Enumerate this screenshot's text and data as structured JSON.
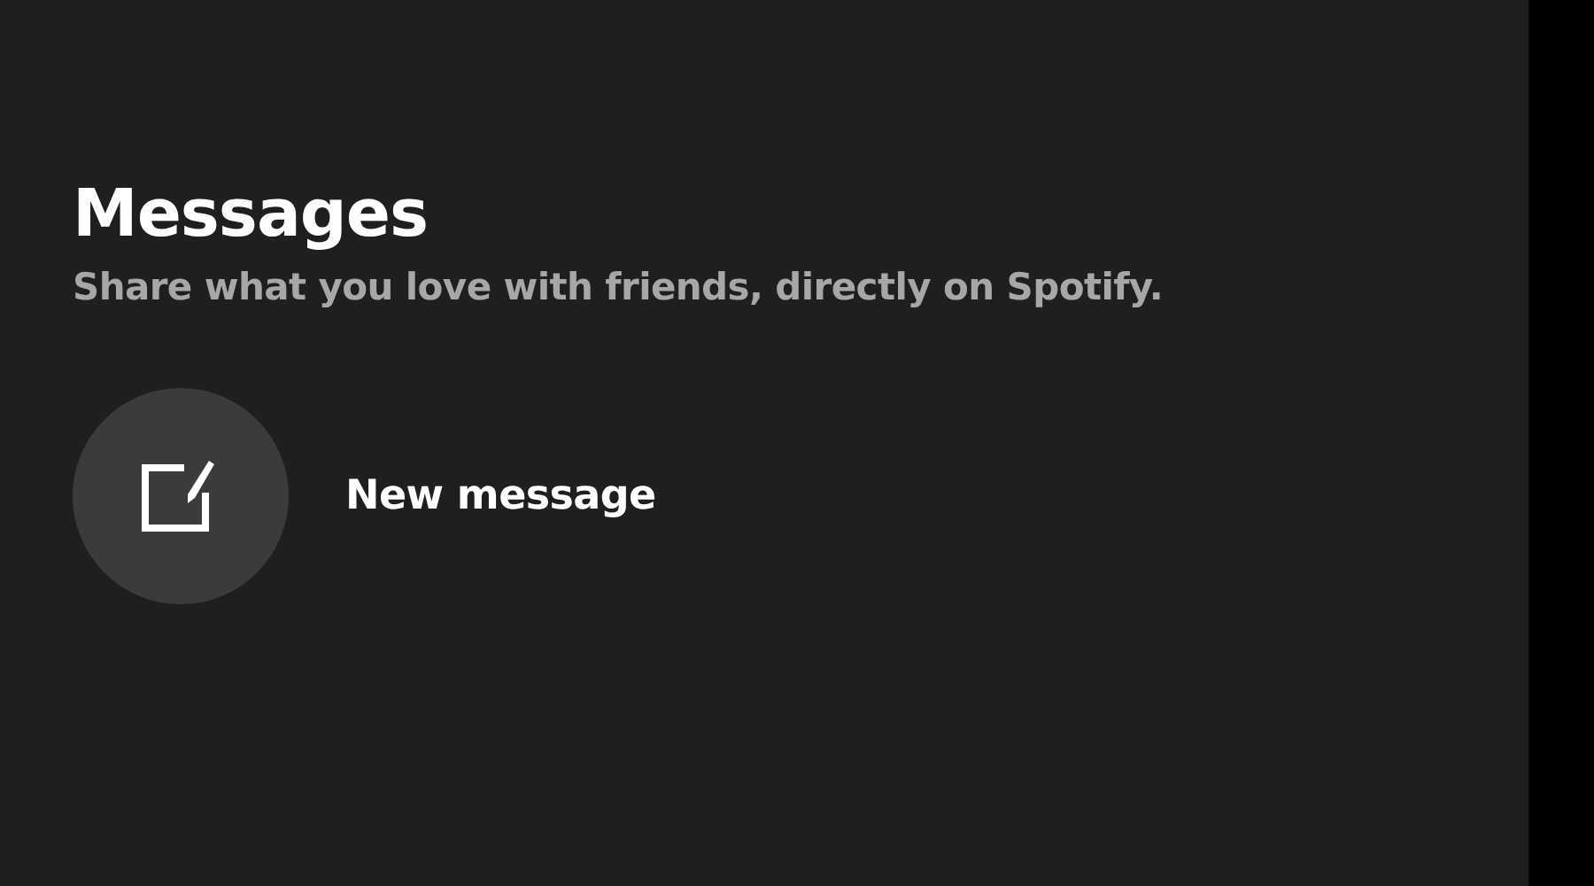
{
  "header": {
    "title": "Messages",
    "subtitle": "Share what you love with friends, directly on Spotify."
  },
  "actions": [
    {
      "kind": "compose",
      "label": "New message"
    }
  ]
}
